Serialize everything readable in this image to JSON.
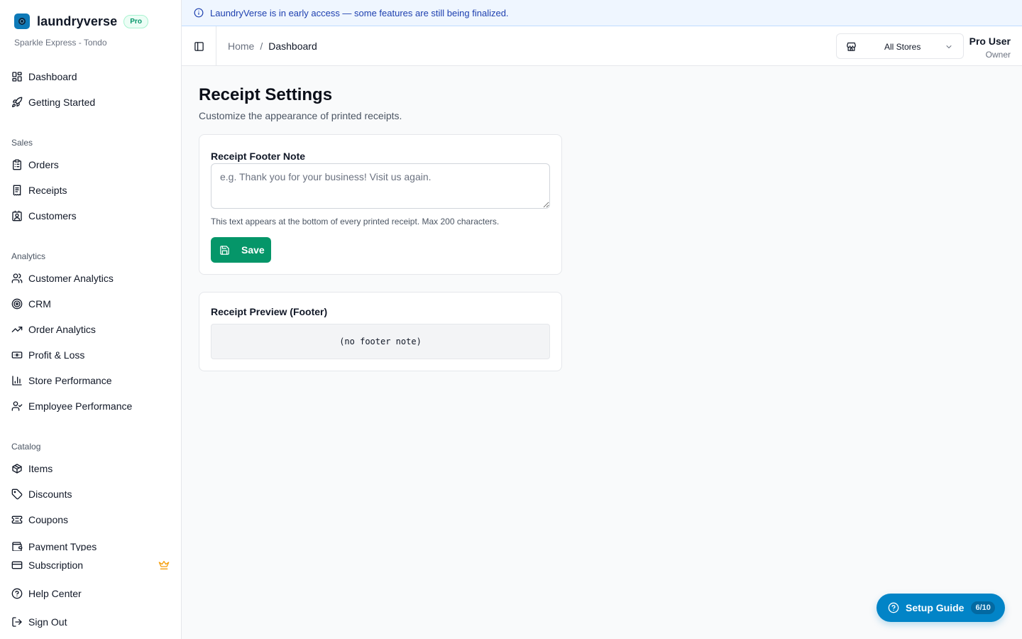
{
  "banner": {
    "text": "LaundryVerse is in early access — some features are still being finalized."
  },
  "brand": {
    "name": "laundryverse",
    "badge": "Pro",
    "store": "Sparkle Express - Tondo"
  },
  "nav": {
    "dashboard": "Dashboard",
    "getting_started": "Getting Started",
    "sales_title": "Sales",
    "orders": "Orders",
    "receipts": "Receipts",
    "customers": "Customers",
    "analytics_title": "Analytics",
    "customer_analytics": "Customer Analytics",
    "crm": "CRM",
    "order_analytics": "Order Analytics",
    "profit_loss": "Profit & Loss",
    "store_performance": "Store Performance",
    "employee_performance": "Employee Performance",
    "catalog_title": "Catalog",
    "items": "Items",
    "discounts": "Discounts",
    "coupons": "Coupons",
    "payment_types": "Payment Types",
    "subscription": "Subscription",
    "help_center": "Help Center",
    "sign_out": "Sign Out"
  },
  "header": {
    "breadcrumb_home": "Home",
    "breadcrumb_sep": "/",
    "breadcrumb_current": "Dashboard",
    "store_select": "All Stores",
    "user_name": "Pro User",
    "user_role": "Owner"
  },
  "page": {
    "title": "Receipt Settings",
    "subtitle": "Customize the appearance of printed receipts."
  },
  "footer_card": {
    "label": "Receipt Footer Note",
    "value": "",
    "placeholder": "e.g. Thank you for your business! Visit us again.",
    "help": "This text appears at the bottom of every printed receipt. Max 200 characters.",
    "save_label": "Save"
  },
  "preview_card": {
    "label": "Receipt Preview (Footer)",
    "content": "(no footer note)"
  },
  "setup_guide": {
    "label": "Setup Guide",
    "progress": "6/10"
  },
  "colors": {
    "primary": "#059669",
    "accent": "#0284c7",
    "banner_text": "#1e40af",
    "crown": "#f59e0b"
  }
}
